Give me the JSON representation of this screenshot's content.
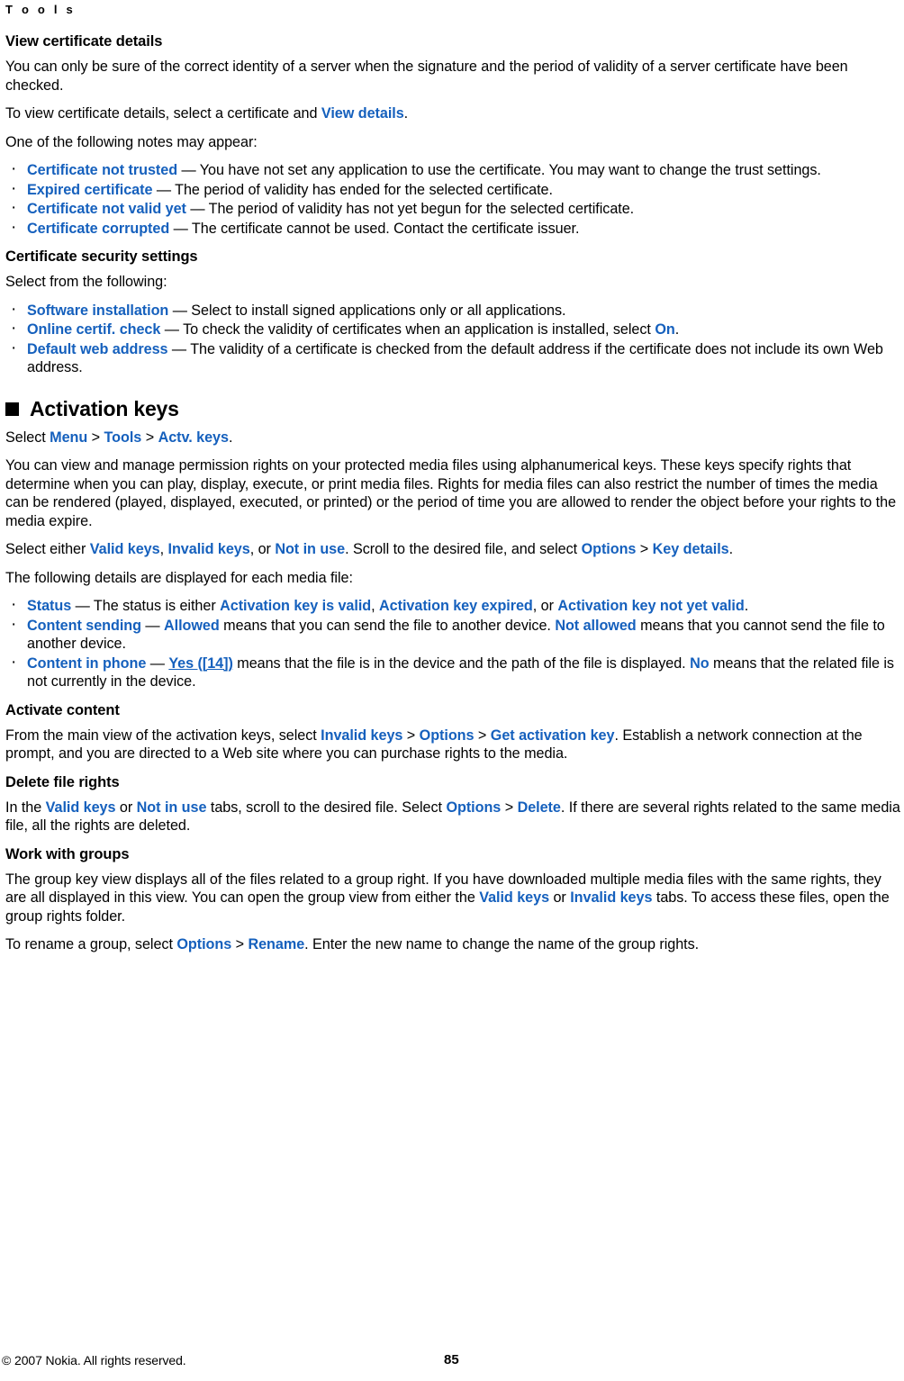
{
  "header": {
    "running_title": "T o o l s"
  },
  "colors": {
    "link_blue": "#1560BD",
    "text_black": "#000000",
    "page_background": "#FFFFFF"
  },
  "sections": {
    "view_certificate_details": {
      "heading": "View certificate details",
      "para_1": "You can only be sure of the correct identity of a server when the signature and the period of validity of a server certificate have been checked.",
      "para_2_a": "To view certificate details, select a certificate and ",
      "para_2_link": "View details",
      "para_2_b": ".",
      "para_3": "One of the following notes may appear:",
      "bullets": [
        {
          "link": "Certificate not trusted",
          "rest": " — You have not set any application to use the certificate. You may want to change the trust settings."
        },
        {
          "link": "Expired certificate",
          "rest": " — The period of validity has ended for the selected certificate."
        },
        {
          "link": "Certificate not valid yet",
          "rest": " — The period of validity has not yet begun for the selected certificate."
        },
        {
          "link": "Certificate corrupted ",
          "rest": " — The certificate cannot be used. Contact the certificate issuer."
        }
      ]
    },
    "certificate_security_settings": {
      "heading": "Certificate security settings",
      "intro": "Select from the following:",
      "bullets": [
        {
          "link": "Software installation",
          "rest": " — Select to install signed applications only or all applications.",
          "tail_link": "",
          "tail": ""
        },
        {
          "link": "Online certif. check",
          "rest": " — To check the validity of certificates when an application is installed, select ",
          "tail_link": "On",
          "tail": "."
        },
        {
          "link": "Default web address",
          "rest": " — The validity of a certificate is checked from the default address if the certificate does not include its own Web address.",
          "tail_link": "",
          "tail": ""
        }
      ]
    },
    "activation_keys": {
      "heading": "Activation keys",
      "path_prefix": "Select ",
      "path_items": [
        "Menu",
        "Tools",
        "Actv. keys"
      ],
      "path_separator": " > ",
      "path_suffix": ".",
      "para_1": "You can view and manage permission rights on your protected media files using alphanumerical keys. These keys specify rights that determine when you can play, display, execute, or print media files. Rights for media files can also restrict the number of times the media can be rendered (played, displayed, executed, or printed) or the period of time you are allowed to render the object before your rights to the media expire.",
      "para_2": {
        "a": "Select either ",
        "l1": "Valid keys",
        "b": ", ",
        "l2": "Invalid keys",
        "c": ", or ",
        "l3": "Not in use",
        "d": ". Scroll to the desired file, and select ",
        "l4": "Options",
        "sep": " > ",
        "l5": "Key details",
        "e": "."
      },
      "para_3": "The following details are displayed for each media file:",
      "detail_bullets": [
        {
          "link": "Status",
          "mid": " — The status is either ",
          "v1": "Activation key is valid",
          "s1": ", ",
          "v2": "Activation key expired",
          "s2": ", or ",
          "v3": "Activation key not yet valid",
          "end": "."
        },
        {
          "link": "Content sending",
          "mid": " — ",
          "v1": "Allowed",
          "s1": " means that you can send the file to another device. ",
          "v2": "Not allowed",
          "s2": " means that you cannot send the file to another device.",
          "v3": "",
          "end": ""
        },
        {
          "link": "Content in phone",
          "mid": " — ",
          "v1": "Yes ([14])",
          "s1": " means that the file is in the device and the path of the file is displayed. ",
          "v2": "No",
          "s2": " means that the related file is not currently in the device.",
          "v3": "",
          "end": ""
        }
      ],
      "activate_content": {
        "heading": "Activate content",
        "a": "From the main view of the activation keys, select ",
        "l1": "Invalid keys",
        "sep1": " > ",
        "l2": "Options",
        "sep2": " > ",
        "l3": "Get activation key",
        "b": ". Establish a network connection at the prompt, and you are directed to a Web site where you can purchase rights to the media."
      },
      "delete_file_rights": {
        "heading": "Delete file rights",
        "a": "In the ",
        "l1": "Valid keys",
        "b": " or ",
        "l2": "Not in use",
        "c": " tabs, scroll to the desired file. Select ",
        "l3": "Options",
        "sep": " > ",
        "l4": "Delete",
        "d": ". If there are several rights related to the same media file, all the rights are deleted."
      },
      "work_with_groups": {
        "heading": "Work with groups",
        "a": "The group key view displays all of the files related to a group right. If you have downloaded multiple media files with the same rights, they are all displayed in this view. You can open the group view from either the ",
        "l1": "Valid keys",
        "b": " or ",
        "l2": "Invalid keys",
        "c": " tabs. To access these files, open the group rights folder.",
        "rename_a": "To rename a group, select ",
        "rl1": "Options",
        "rsep": " > ",
        "rl2": "Rename",
        "rename_b": ". Enter the new name to change the name of the group rights."
      }
    }
  },
  "footer": {
    "copyright": "© 2007 Nokia. All rights reserved.",
    "page_number": "85"
  }
}
